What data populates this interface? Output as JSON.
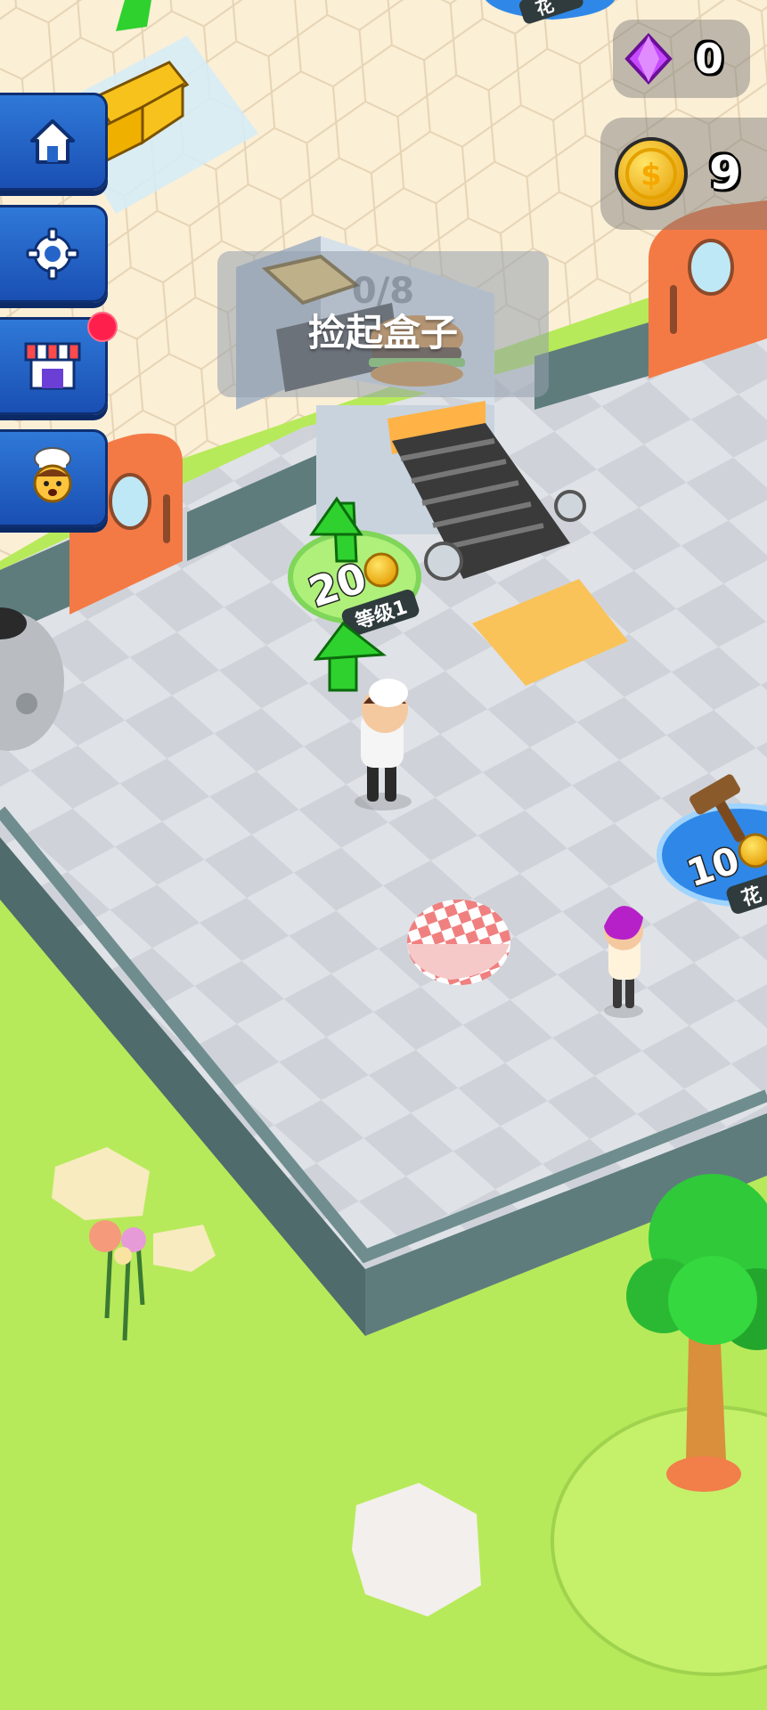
{
  "hud": {
    "gems": "0",
    "coins": "9"
  },
  "sidebar": {
    "buttons": [
      "home-icon",
      "gear-icon",
      "shop-icon",
      "chef-icon"
    ],
    "shop_has_notification": true
  },
  "task": {
    "progress": "0/8",
    "label": "捡起盒子"
  },
  "upgrade_spot": {
    "cost": "20",
    "level_label": "等级1"
  },
  "purchase_spot_right": {
    "cost": "10",
    "label_partial": "花"
  },
  "top_spot_label_partial": "花",
  "colors": {
    "grass": "#b7ea5a",
    "floor": "#d9dde3",
    "tile_floor": "#fbefd6",
    "wall": "#5f7c7d",
    "door": "#f47a45",
    "button_blue": "#2565c9",
    "gem": "#c64bff",
    "coin": "#f7c21c",
    "arrow": "#2fd12f"
  }
}
